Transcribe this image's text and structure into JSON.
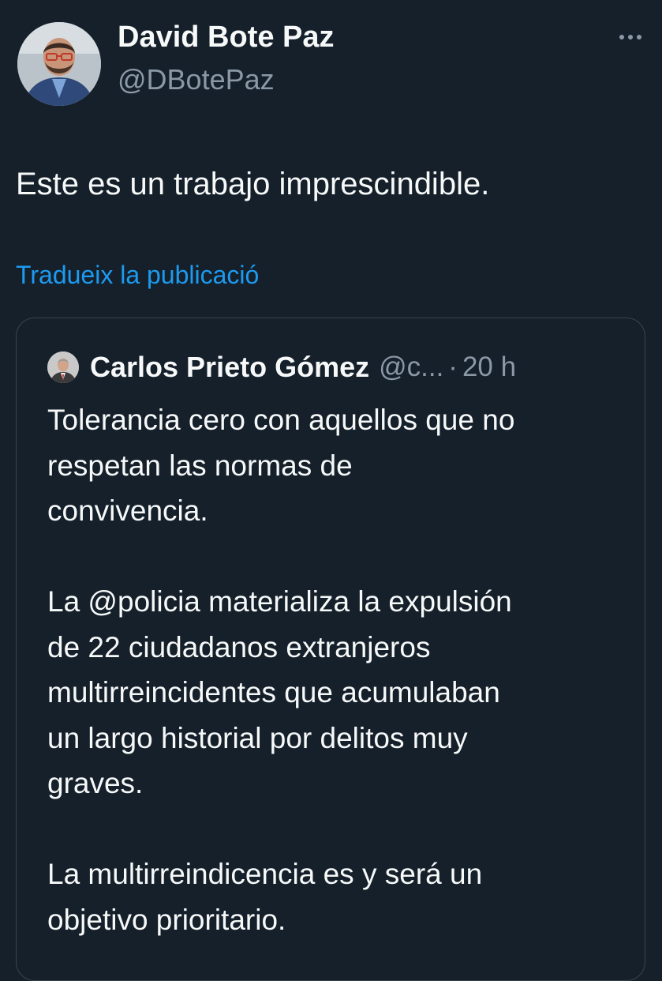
{
  "tweet": {
    "author": {
      "display_name": "David Bote Paz",
      "handle": "@DBotePaz",
      "avatar_icon": "profile-photo-avatar"
    },
    "more_icon": "more-options-icon",
    "text": "Este es un trabajo imprescindible.",
    "translate_label": "Tradueix la publicació"
  },
  "quoted_tweet": {
    "author": {
      "display_name": "Carlos Prieto Gómez",
      "handle": "@c...",
      "avatar_icon": "profile-photo-avatar"
    },
    "separator": "·",
    "time": "20 h",
    "paragraphs": [
      {
        "lines": [
          "Tolerancia cero con aquellos que no",
          "respetan las normas de",
          "convivencia."
        ]
      },
      {
        "lines": [
          "La @policia materializa la expulsión",
          "de 22 ciudadanos extranjeros",
          "multirreincidentes que acumulaban",
          "un largo historial por delitos muy",
          "graves."
        ]
      },
      {
        "lines": [
          "La multirreindicencia es y será un",
          "objetivo prioritario."
        ]
      }
    ]
  },
  "colors": {
    "background": "#15202b",
    "text_primary": "#f7f9f9",
    "text_secondary": "#8b98a5",
    "link": "#1d9bf0",
    "border": "#38444d"
  }
}
